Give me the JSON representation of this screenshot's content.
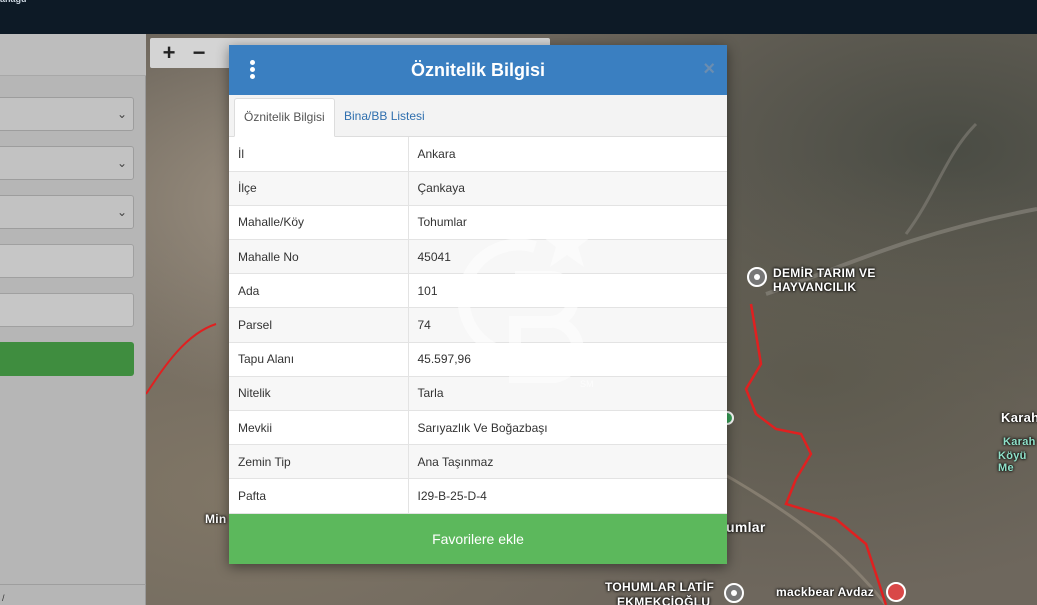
{
  "app": {
    "brand_fragment": "anagu"
  },
  "map": {
    "zoom_in": "+",
    "zoom_out": "−",
    "labels": {
      "demir": "DEMİR TARIM VE",
      "demir2": "HAYVANCILIK",
      "kara": "Karah",
      "kara2": "Karah",
      "kara3": "Köyü Me",
      "min": "Min",
      "umlar": "umlar",
      "tohumlar_latif": "TOHUMLAR LATİF",
      "ekmekcioglu": "EKMEKÇİOĞLU",
      "mackbear": "mackbear Avdaz"
    }
  },
  "sidebar": {
    "footer_text": "/"
  },
  "modal": {
    "title": "Öznitelik Bilgisi",
    "close_label": "×",
    "tabs": [
      {
        "label": "Öznitelik Bilgisi",
        "active": true
      },
      {
        "label": "Bina/BB Listesi",
        "active": false
      }
    ],
    "rows": [
      {
        "key": "İl",
        "value": "Ankara"
      },
      {
        "key": "İlçe",
        "value": "Çankaya"
      },
      {
        "key": "Mahalle/Köy",
        "value": "Tohumlar"
      },
      {
        "key": "Mahalle No",
        "value": "45041"
      },
      {
        "key": "Ada",
        "value": "101"
      },
      {
        "key": "Parsel",
        "value": "74"
      },
      {
        "key": "Tapu Alanı",
        "value": "45.597,96"
      },
      {
        "key": "Nitelik",
        "value": "Tarla"
      },
      {
        "key": "Mevkii",
        "value": "Sarıyazlık Ve Boğazbaşı"
      },
      {
        "key": "Zemin Tip",
        "value": "Ana Taşınmaz"
      },
      {
        "key": "Pafta",
        "value": "I29-B-25-D-4"
      }
    ],
    "action_label": "Favorilere ekle"
  },
  "watermark": {
    "mark": "SM"
  },
  "colors": {
    "header_blue": "#3a7fc1",
    "action_green": "#5cb85c",
    "tab_link_blue": "#2f6fae",
    "boundary_red": "#e02020",
    "topbar": "#0d1a26"
  }
}
